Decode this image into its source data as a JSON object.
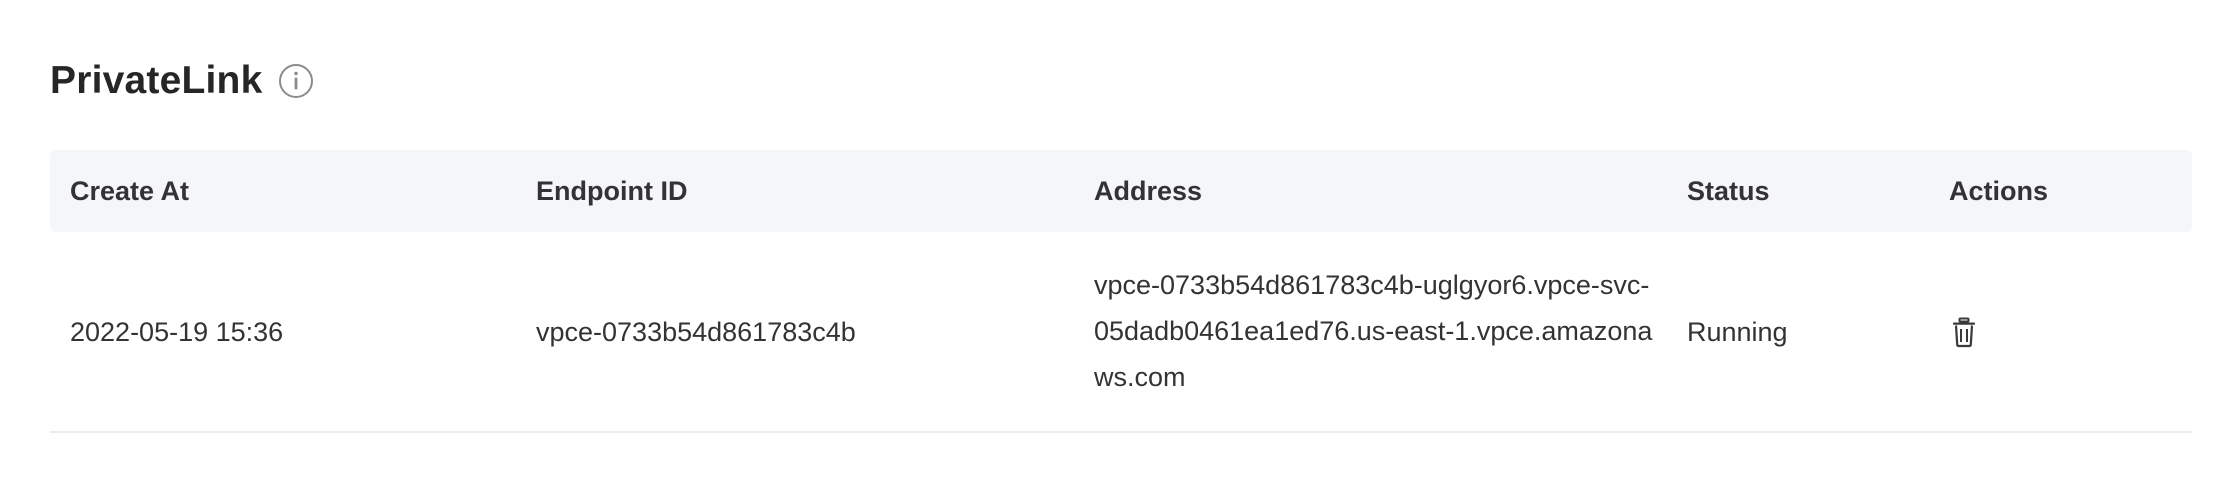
{
  "section": {
    "title": "PrivateLink",
    "info_icon": "info-circle-icon"
  },
  "table": {
    "columns": [
      {
        "key": "create_at",
        "label": "Create At"
      },
      {
        "key": "endpoint_id",
        "label": "Endpoint ID"
      },
      {
        "key": "address",
        "label": "Address"
      },
      {
        "key": "status",
        "label": "Status"
      },
      {
        "key": "actions",
        "label": "Actions"
      }
    ],
    "rows": [
      {
        "create_at": "2022-05-19 15:36",
        "endpoint_id": "vpce-0733b54d861783c4b",
        "address": "vpce-0733b54d861783c4b-uglgyor6.vpce-svc-05dadb0461ea1ed76.us-east-1.vpce.amazonaws.com",
        "status": "Running",
        "action_icon": "trash-icon"
      }
    ]
  }
}
